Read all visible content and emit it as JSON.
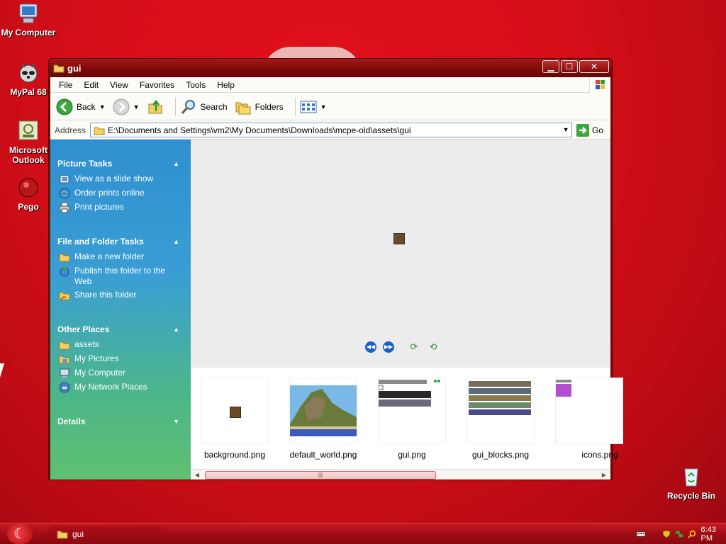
{
  "desktop": {
    "icons": [
      {
        "label": "My Computer"
      },
      {
        "label": "MyPal 68"
      },
      {
        "label": "Microsoft Outlook"
      },
      {
        "label": "Pego"
      },
      {
        "label": "Recycle Bin"
      }
    ]
  },
  "window": {
    "title": "gui",
    "buttons": {
      "minimize": "▁",
      "maximize": "☐",
      "close": "✕"
    }
  },
  "menu": [
    "File",
    "Edit",
    "View",
    "Favorites",
    "Tools",
    "Help"
  ],
  "toolbar": {
    "back": "Back",
    "search": "Search",
    "folders": "Folders"
  },
  "address": {
    "label": "Address",
    "value": "E:\\Documents and Settings\\vm2\\My Documents\\Downloads\\mcpe-old\\assets\\gui",
    "go": "Go"
  },
  "tasks": {
    "picture_tasks": {
      "title": "Picture Tasks",
      "items": [
        "View as a slide show",
        "Order prints online",
        "Print pictures"
      ]
    },
    "file_folder_tasks": {
      "title": "File and Folder Tasks",
      "items": [
        "Make a new folder",
        "Publish this folder to the Web",
        "Share this folder"
      ]
    },
    "other_places": {
      "title": "Other Places",
      "items": [
        "assets",
        "My Pictures",
        "My Computer",
        "My Network Places"
      ]
    },
    "details": {
      "title": "Details"
    }
  },
  "files": [
    {
      "name": "background.png"
    },
    {
      "name": "default_world.png"
    },
    {
      "name": "gui.png"
    },
    {
      "name": "gui_blocks.png"
    },
    {
      "name": "icons.png"
    }
  ],
  "taskbar": {
    "task": "gui",
    "clock": "6:43 PM"
  },
  "colors": {
    "desktop": "#d40e18",
    "titlebar": "#7a0a0a",
    "taskpane_top": "#2f8fd0",
    "taskpane_bottom": "#60c070"
  }
}
